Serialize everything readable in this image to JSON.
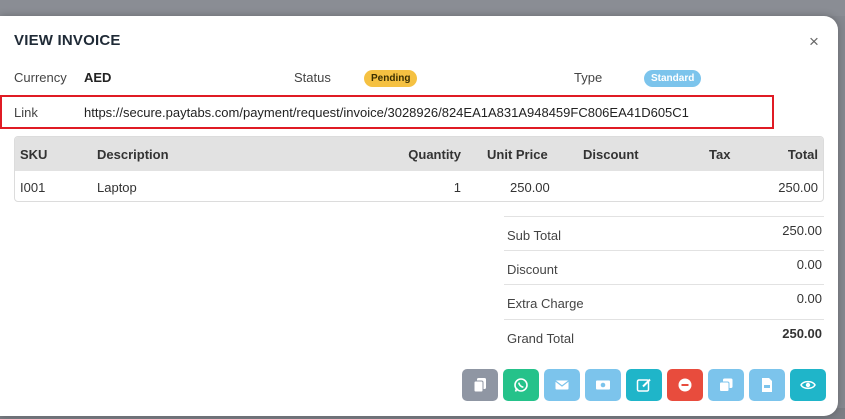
{
  "modal": {
    "title": "VIEW INVOICE",
    "close_icon": "×"
  },
  "info": {
    "currency_label": "Currency",
    "currency_value": "AED",
    "status_label": "Status",
    "status_value": "Pending",
    "type_label": "Type",
    "type_value": "Standard",
    "link_label": "Link",
    "link_value": "https://secure.paytabs.com/payment/request/invoice/3028926/824EA1A831A948459FC806EA41D605C1"
  },
  "table": {
    "headers": [
      "SKU",
      "Description",
      "Quantity",
      "Unit Price",
      "Discount",
      "Tax",
      "Total"
    ],
    "rows": [
      {
        "sku": "I001",
        "description": "Laptop",
        "quantity": "1",
        "unit_price": "250.00",
        "discount": "",
        "tax": "",
        "total": "250.00"
      }
    ]
  },
  "totals": {
    "sub_total_label": "Sub Total",
    "sub_total_value": "250.00",
    "discount_label": "Discount",
    "discount_value": "0.00",
    "extra_charge_label": "Extra Charge",
    "extra_charge_value": "0.00",
    "grand_total_label": "Grand Total",
    "grand_total_value": "250.00"
  },
  "actions": [
    {
      "name": "copy-link-button",
      "icon": "copy-icon",
      "color": "#8f96a3"
    },
    {
      "name": "whatsapp-button",
      "icon": "whatsapp-icon",
      "color": "#25c28a"
    },
    {
      "name": "email-button",
      "icon": "envelope-icon",
      "color": "#7cc4ec"
    },
    {
      "name": "payment-button",
      "icon": "money-icon",
      "color": "#7cc4ec"
    },
    {
      "name": "edit-button",
      "icon": "edit-icon",
      "color": "#1fb5c9"
    },
    {
      "name": "cancel-invoice-button",
      "icon": "minus-circle-icon",
      "color": "#e84c3d"
    },
    {
      "name": "duplicate-button",
      "icon": "clone-icon",
      "color": "#7cc4ec"
    },
    {
      "name": "pdf-button",
      "icon": "pdf-icon",
      "color": "#7cc4ec"
    },
    {
      "name": "view-button",
      "icon": "eye-icon",
      "color": "#1fb5c9"
    }
  ]
}
